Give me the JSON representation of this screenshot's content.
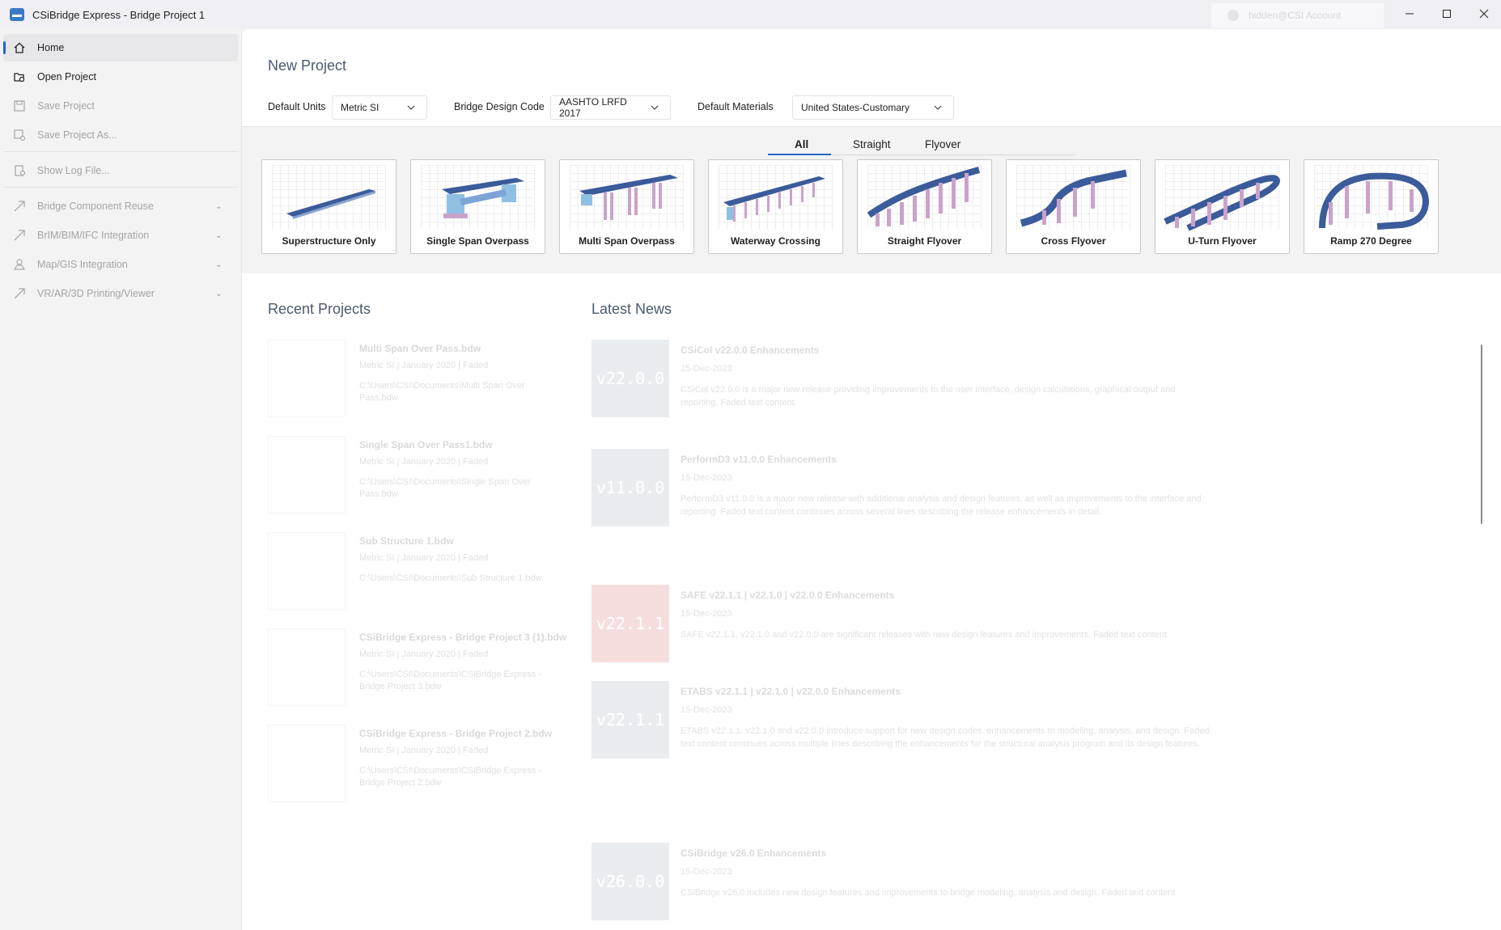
{
  "window": {
    "title": "CSiBridge Express - Bridge Project 1",
    "account": "hidden@CSI Account"
  },
  "sidebar": {
    "items": [
      {
        "label": "Home"
      },
      {
        "label": "Open Project"
      },
      {
        "label": "Save Project"
      },
      {
        "label": "Save Project As..."
      },
      {
        "label": "Show Log File..."
      },
      {
        "label": "Bridge Component Reuse"
      },
      {
        "label": "BrIM/BIM/IFC Integration"
      },
      {
        "label": "Map/GIS Integration"
      },
      {
        "label": "VR/AR/3D Printing/Viewer"
      }
    ]
  },
  "new_project": {
    "title": "New Project",
    "units_label": "Default Units",
    "units_value": "Metric SI",
    "code_label": "Bridge Design Code",
    "code_value": "AASHTO LRFD 2017",
    "materials_label": "Default Materials",
    "materials_value": "United States-Customary"
  },
  "tabs": [
    {
      "label": "All"
    },
    {
      "label": "Straight"
    },
    {
      "label": "Flyover"
    }
  ],
  "templates": [
    {
      "label": "Superstructure Only"
    },
    {
      "label": "Single Span Overpass"
    },
    {
      "label": "Multi Span Overpass"
    },
    {
      "label": "Waterway Crossing"
    },
    {
      "label": "Straight Flyover"
    },
    {
      "label": "Cross Flyover"
    },
    {
      "label": "U-Turn Flyover"
    },
    {
      "label": "Ramp 270 Degree"
    }
  ],
  "recent": {
    "title": "Recent Projects",
    "items": [
      {
        "name": "Multi Span Over Pass.bdw",
        "meta": "Metric SI | January 2020 | Faded",
        "path": "C:\\Users\\CSI\\Documents\\Multi Span Over Pass.bdw"
      },
      {
        "name": "Single Span Over Pass1.bdw",
        "meta": "Metric SI | January 2020 | Faded",
        "path": "C:\\Users\\CSI\\Documents\\Single Span Over Pass.bdw"
      },
      {
        "name": "Sub Structure 1.bdw",
        "meta": "Metric SI | January 2020 | Faded",
        "path": "C:\\Users\\CSI\\Documents\\Sub Structure 1.bdw"
      },
      {
        "name": "CSiBridge Express - Bridge Project 3 (1).bdw",
        "meta": "Metric SI | January 2020 | Faded",
        "path": "C:\\Users\\CSI\\Documents\\CSiBridge Express - Bridge Project 3.bdw"
      },
      {
        "name": "CSiBridge Express - Bridge Project 2.bdw",
        "meta": "Metric SI | January 2020 | Faded",
        "path": "C:\\Users\\CSI\\Documents\\CSiBridge Express - Bridge Project 2.bdw"
      }
    ]
  },
  "news": {
    "title": "Latest News",
    "items": [
      {
        "thumb": "v22.0.0",
        "title": "CSiCol v22.0.0 Enhancements",
        "date": "15-Dec-2023",
        "body": "CSiCol v22.0.0 is a major new release providing improvements to the user interface, design calculations, graphical output and reporting. Faded text content."
      },
      {
        "thumb": "v11.0.0",
        "title": "PerformD3 v11.0.0 Enhancements",
        "date": "15-Dec-2023",
        "body": "PerformD3 v11.0.0 is a major new release with additional analysis and design features, as well as improvements to the interface and reporting. Faded text content continues across several lines describing the release enhancements in detail."
      },
      {
        "thumb": "v22.1.1",
        "title": "SAFE v22.1.1 | v22.1.0 | v22.0.0 Enhancements",
        "date": "15-Dec-2023",
        "body": "SAFE v22.1.1, v22.1.0 and v22.0.0 are significant releases with new design features and improvements. Faded text content."
      },
      {
        "thumb": "v22.1.1",
        "title": "ETABS v22.1.1 | v22.1.0 | v22.0.0 Enhancements",
        "date": "15-Dec-2023",
        "body": "ETABS v22.1.1, v22.1.0 and v22.0.0 introduce support for new design codes, enhancements to modeling, analysis, and design. Faded text content continues across multiple lines describing the enhancements for the structural analysis program and its design features."
      },
      {
        "thumb": "v26.0.0",
        "title": "CSiBridge v26.0 Enhancements",
        "date": "15-Dec-2023",
        "body": "CSiBridge v26.0 includes new design features and improvements to bridge modeling, analysis and design. Faded text content."
      }
    ]
  }
}
